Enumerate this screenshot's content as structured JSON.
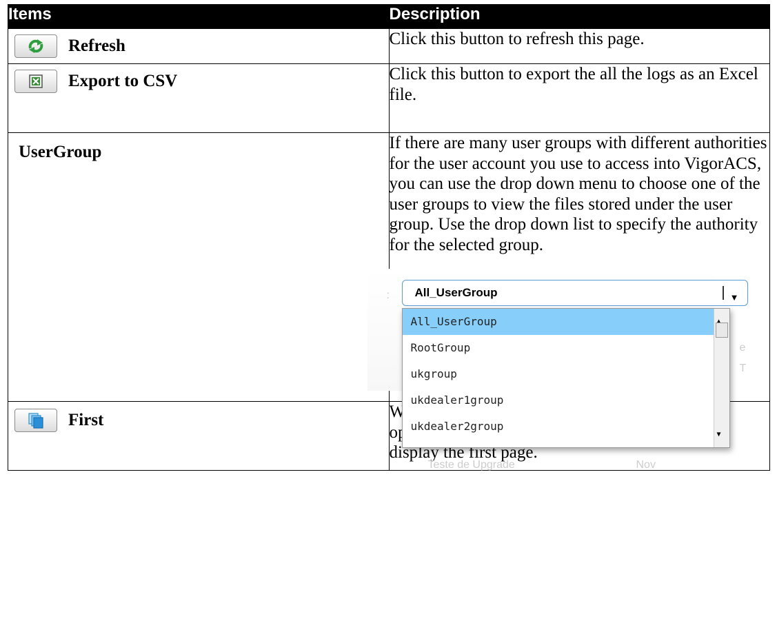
{
  "table": {
    "headers": {
      "items": "Items",
      "description": "Description"
    },
    "rows": [
      {
        "label": "Refresh",
        "icon": "refresh-icon",
        "description": "Click this button to refresh this page."
      },
      {
        "label": "Export to CSV",
        "icon": "excel-icon",
        "description": "Click this button to export the all the logs as an Excel file."
      },
      {
        "label": "UserGroup",
        "description": "If there are many user groups with different authorities for the user account you use to access into VigorACS, you can use the drop down menu to choose one of the user groups to view the files stored under the user group. Use the drop down list to specify the authority for the selected group."
      },
      {
        "label": "First",
        "icon": "first-page-icon",
        "description": "When there is more than one page for the device operate log in this user group, click this button to display the first page."
      }
    ]
  },
  "dropdown": {
    "selected": "All_UserGroup",
    "options": [
      "All_UserGroup",
      "RootGroup",
      "ukgroup",
      "ukdealer1group",
      "ukdealer2group"
    ],
    "background_text": [
      "Teste de Upgrade",
      "Nov",
      "e T"
    ]
  },
  "colors": {
    "header_bg": "#000000",
    "selected_option": "#87cefa",
    "refresh_icon": "#2e9e3e",
    "excel_icon": "#3c8a3c",
    "first_icon": "#2a8fd6"
  }
}
